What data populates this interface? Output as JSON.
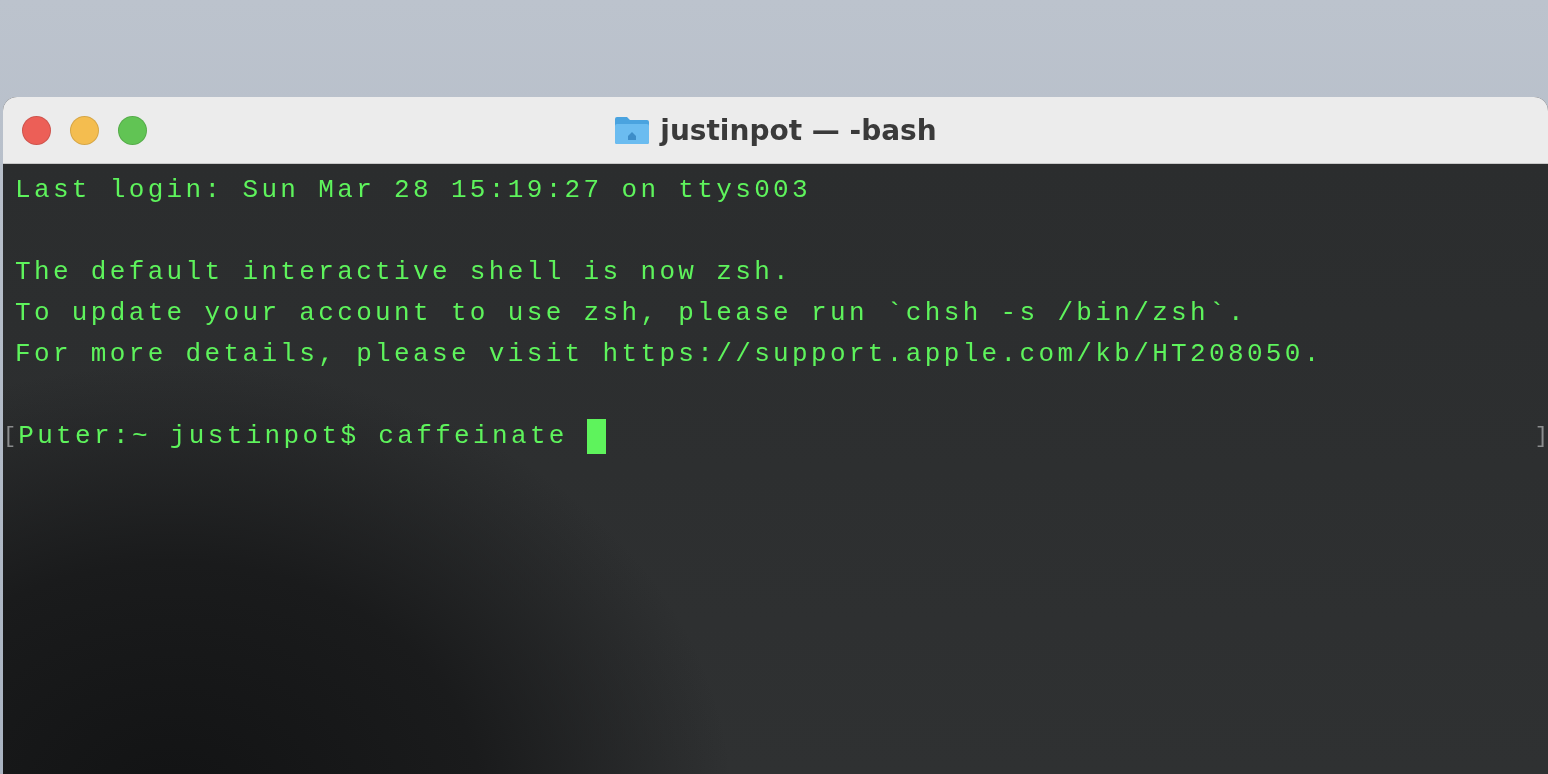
{
  "window": {
    "title": "justinpot — -bash"
  },
  "output_blocks": [
    [
      "Last login: Sun Mar 28 15:19:27 on ttys003"
    ],
    [
      "The default interactive shell is now zsh.",
      "To update your account to use zsh, please run `chsh -s /bin/zsh`.",
      "For more details, please visit https://support.apple.com/kb/HT208050."
    ]
  ],
  "prompt": {
    "mark_left": "[",
    "text": "Puter:~ justinpot$ caffeinate ",
    "cursor": true,
    "mark_right": "]"
  }
}
